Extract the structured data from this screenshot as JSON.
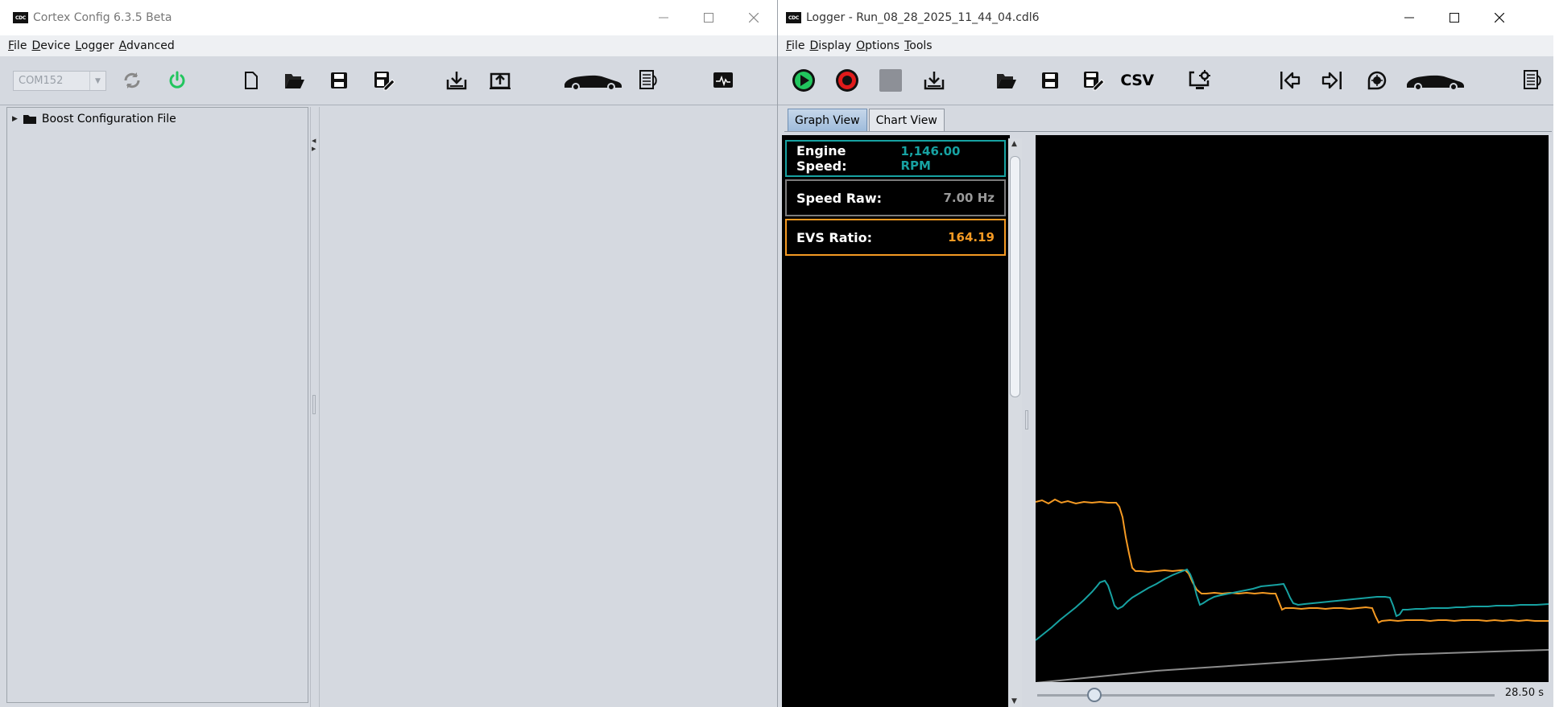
{
  "config_window": {
    "title": "Cortex Config 6.3.5 Beta",
    "app_icon_text": "CDC",
    "menu": [
      "File",
      "Device",
      "Logger",
      "Advanced"
    ],
    "menu_mnemonic": [
      "F",
      "D",
      "L",
      "A"
    ],
    "com_port": "COM152",
    "tree": {
      "root_label": "Boost Configuration File"
    },
    "colors": {
      "power_icon": "#22c55e"
    }
  },
  "logger_window": {
    "title": "Logger - Run_08_28_2025_11_44_04.cdl6",
    "app_icon_text": "CDC",
    "menu": [
      "File",
      "Display",
      "Options",
      "Tools"
    ],
    "menu_mnemonic": [
      "F",
      "D",
      "O",
      "T"
    ],
    "csv_label": "CSV",
    "tabs": [
      "Graph View",
      "Chart View"
    ],
    "active_tab": "Graph View",
    "gauges": [
      {
        "label": "Engine Speed:",
        "value": "1,146.00 RPM",
        "color": "#17a2a2"
      },
      {
        "label": "Speed Raw:",
        "value": "7.00 Hz",
        "color": "#9a9a9a"
      },
      {
        "label": "EVS Ratio:",
        "value": "164.19",
        "color": "#f59a23"
      }
    ],
    "time_readout": "28.50 s",
    "slider_position_fraction": 0.1
  }
}
